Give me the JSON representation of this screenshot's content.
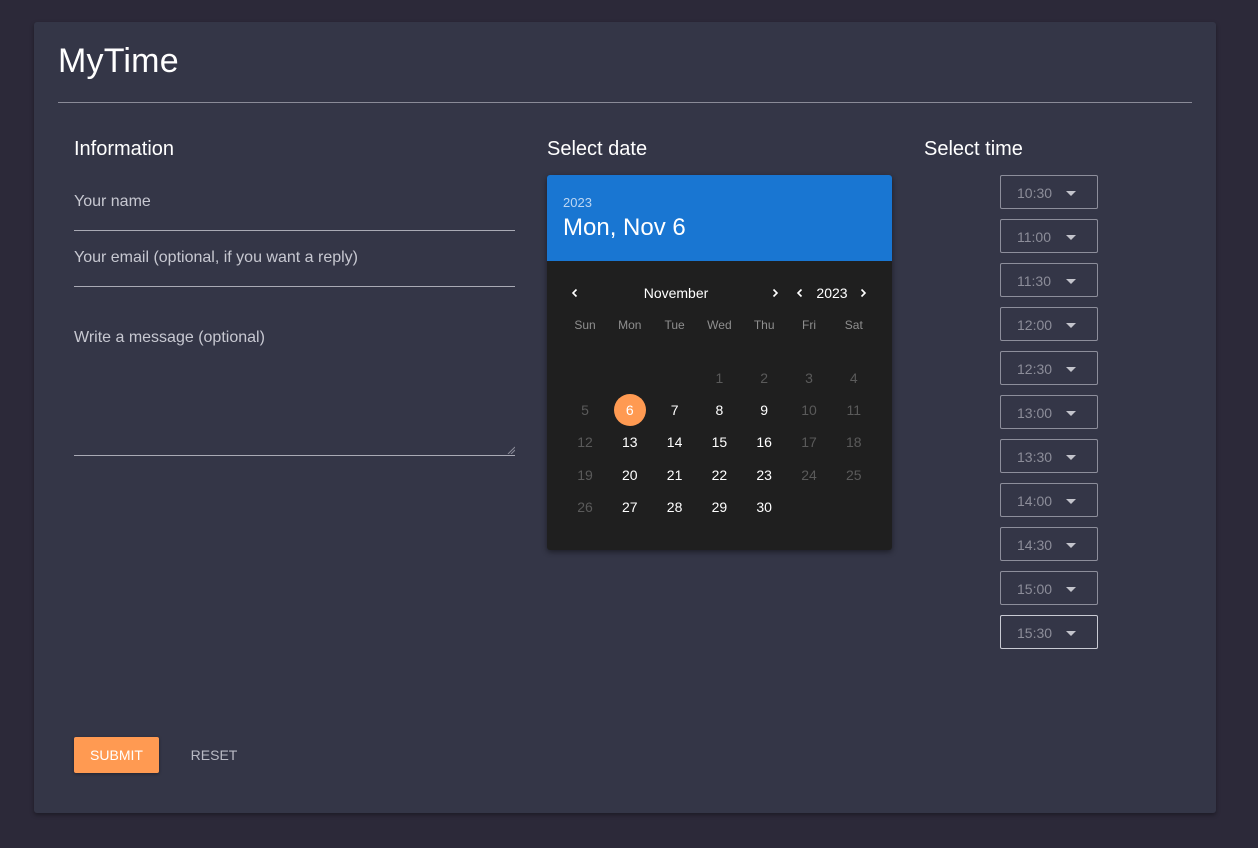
{
  "app": {
    "title": "MyTime"
  },
  "info": {
    "heading": "Information",
    "name_label": "Your name",
    "email_label": "Your email (optional, if you want a reply)",
    "message_label": "Write a message (optional)"
  },
  "date": {
    "heading": "Select date",
    "header_year": "2023",
    "header_date": "Mon, Nov 6",
    "month": "November",
    "year": "2023",
    "weekdays": [
      "Sun",
      "Mon",
      "Tue",
      "Wed",
      "Thu",
      "Fri",
      "Sat"
    ],
    "weeks": [
      [
        null,
        null,
        null,
        1,
        2,
        3,
        4
      ],
      [
        5,
        6,
        7,
        8,
        9,
        10,
        11
      ],
      [
        12,
        13,
        14,
        15,
        16,
        17,
        18
      ],
      [
        19,
        20,
        21,
        22,
        23,
        24,
        25
      ],
      [
        26,
        27,
        28,
        29,
        30,
        null,
        null
      ]
    ],
    "enabled_days": [
      6,
      7,
      8,
      9,
      13,
      14,
      15,
      16,
      20,
      21,
      22,
      23,
      27,
      28,
      29,
      30
    ],
    "selected_day": 6
  },
  "time": {
    "heading": "Select time",
    "slots": [
      "10:30",
      "11:00",
      "11:30",
      "12:00",
      "12:30",
      "13:00",
      "13:30",
      "14:00",
      "14:30",
      "15:00",
      "15:30"
    ]
  },
  "actions": {
    "submit": "Submit",
    "reset": "Reset"
  },
  "colors": {
    "accent": "#ff9a52",
    "picker_header": "#1976d2",
    "card": "#343647",
    "background": "#2c2939"
  }
}
